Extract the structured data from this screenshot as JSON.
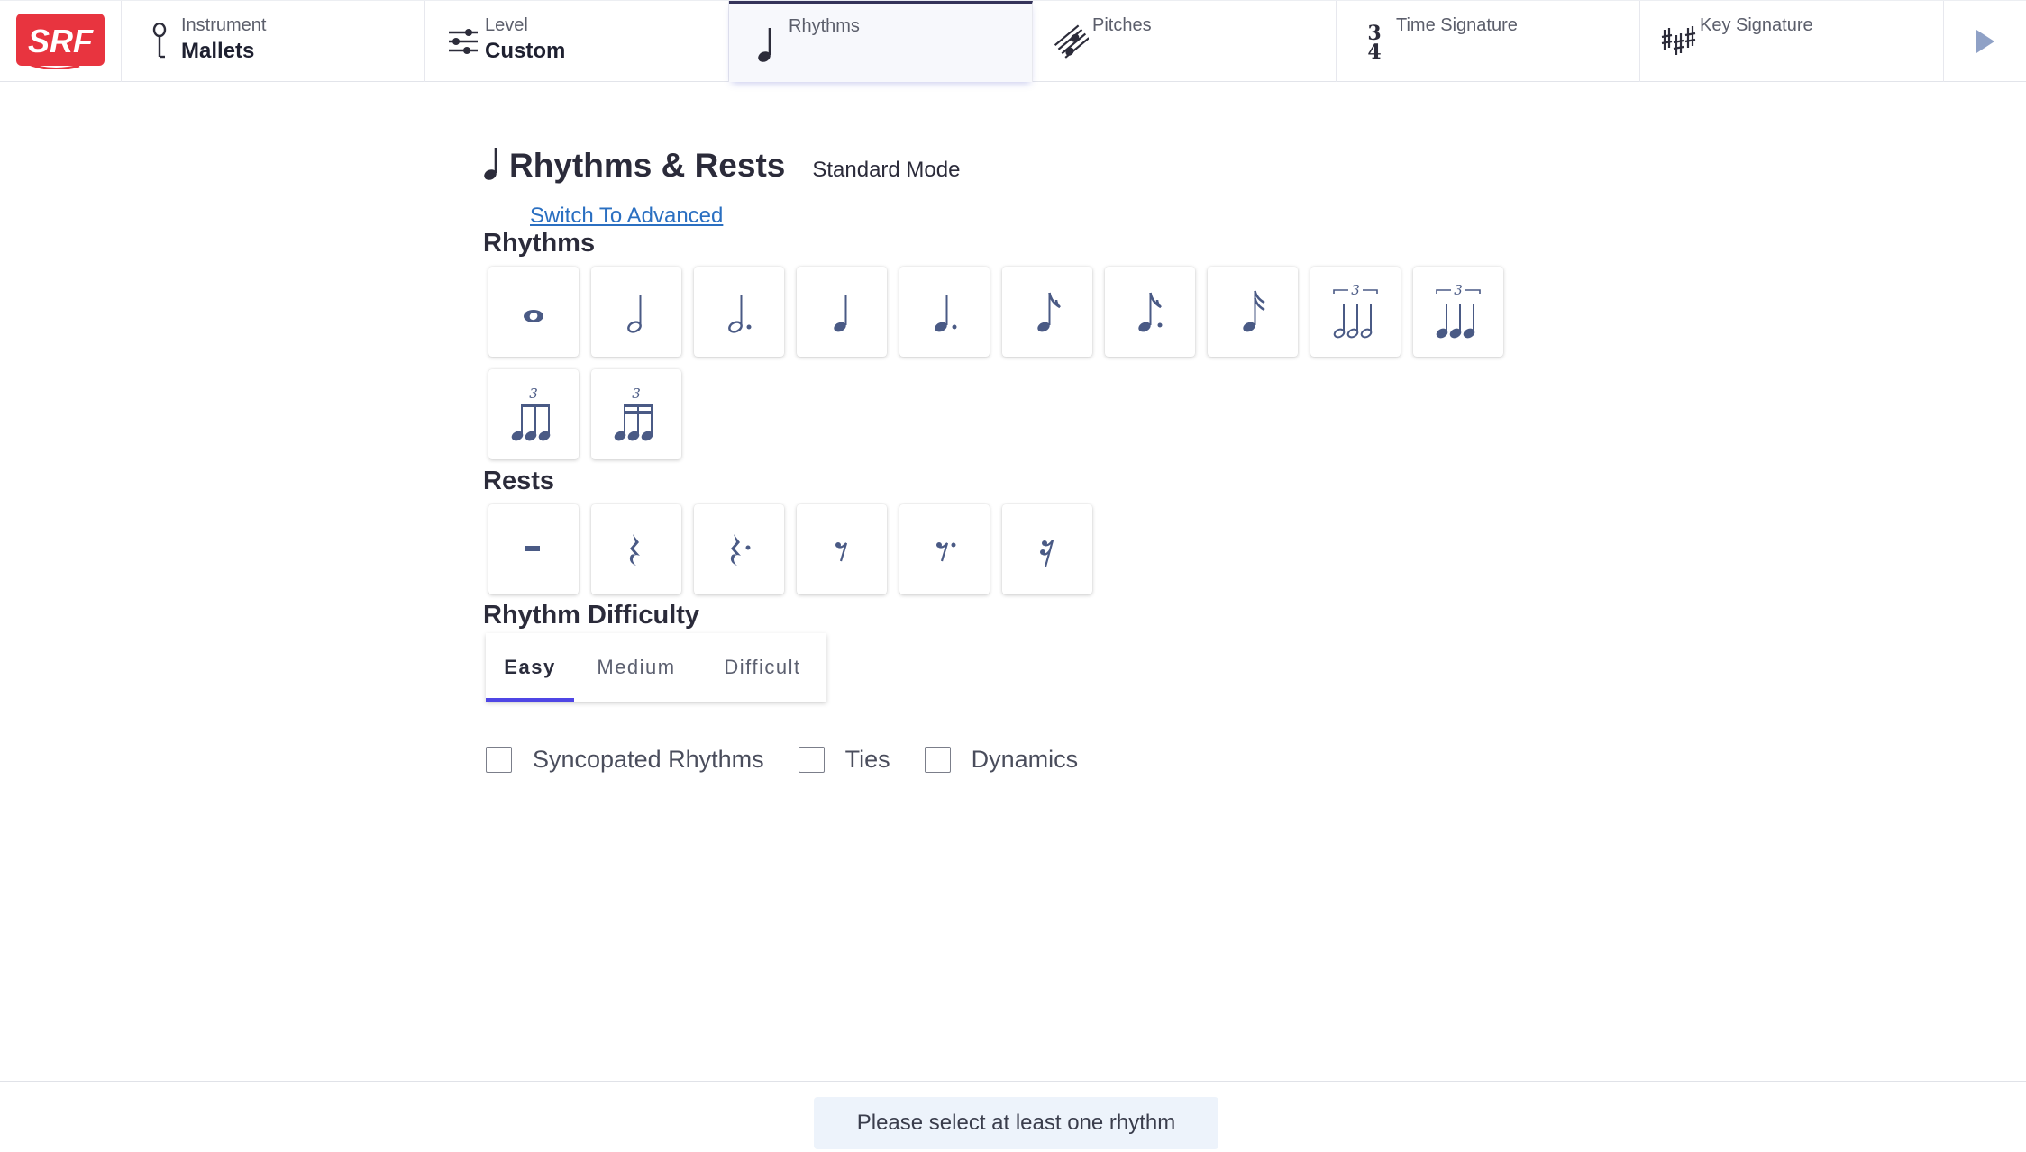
{
  "brand": {
    "logo_text": "SRF",
    "logo_color": "#e8343f"
  },
  "nav": {
    "instrument": {
      "label": "Instrument",
      "value": "Mallets",
      "icon": "mallet-icon"
    },
    "level": {
      "label": "Level",
      "value": "Custom",
      "icon": "sliders-icon"
    },
    "rhythms": {
      "label": "Rhythms",
      "value": "",
      "icon": "quarter-note-icon"
    },
    "pitches": {
      "label": "Pitches",
      "value": "",
      "icon": "notes-icon"
    },
    "time_signature": {
      "label": "Time Signature",
      "value": "",
      "icon": "time-signature-icon",
      "glyph_top": "3",
      "glyph_bottom": "4"
    },
    "key_signature": {
      "label": "Key Signature",
      "value": "",
      "icon": "sharps-icon"
    },
    "next_icon": "play-arrow-icon"
  },
  "page": {
    "title": "Rhythms & Rests",
    "mode": "Standard Mode",
    "switch_link": "Switch To Advanced",
    "rhythms_heading": "Rhythms",
    "rests_heading": "Rests",
    "difficulty_heading": "Rhythm Difficulty"
  },
  "rhythms": [
    {
      "name": "whole-note"
    },
    {
      "name": "half-note"
    },
    {
      "name": "dotted-half-note"
    },
    {
      "name": "quarter-note"
    },
    {
      "name": "dotted-quarter-note"
    },
    {
      "name": "eighth-note"
    },
    {
      "name": "dotted-eighth-note"
    },
    {
      "name": "sixteenth-note"
    },
    {
      "name": "half-note-triplet",
      "tuplet": "3"
    },
    {
      "name": "quarter-note-triplet",
      "tuplet": "3"
    },
    {
      "name": "eighth-note-triplet",
      "tuplet": "3"
    },
    {
      "name": "sixteenth-note-triplet",
      "tuplet": "3"
    }
  ],
  "rests": [
    {
      "name": "whole-rest"
    },
    {
      "name": "quarter-rest"
    },
    {
      "name": "dotted-quarter-rest"
    },
    {
      "name": "eighth-rest"
    },
    {
      "name": "dotted-eighth-rest"
    },
    {
      "name": "sixteenth-rest"
    }
  ],
  "difficulty": {
    "tabs": [
      "Easy",
      "Medium",
      "Difficult"
    ],
    "selected": "Easy"
  },
  "options": [
    {
      "label": "Syncopated Rhythms",
      "checked": false
    },
    {
      "label": "Ties",
      "checked": false
    },
    {
      "label": "Dynamics",
      "checked": false
    }
  ],
  "footer": {
    "status": "Please select at least one rhythm"
  },
  "colors": {
    "accent": "#4f46e5",
    "link": "#2a6fc1",
    "icon": "#4a5a85",
    "nav_dark": "#34335a",
    "status_bg": "#edf3fb"
  }
}
